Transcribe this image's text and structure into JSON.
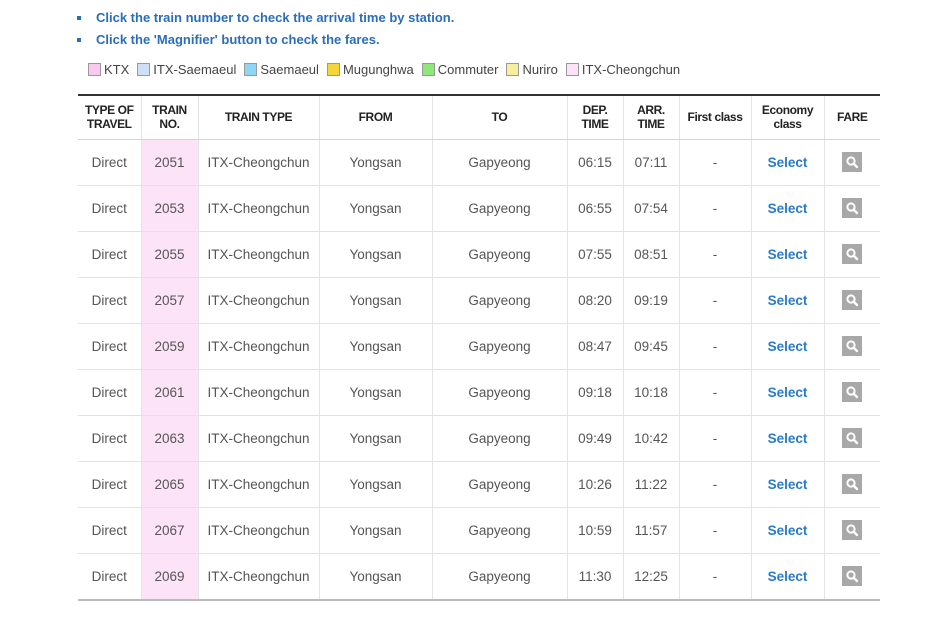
{
  "notes": [
    "Click the train number to check the arrival time by station.",
    "Click the 'Magnifier' button to check the fares."
  ],
  "legend": [
    {
      "label": "KTX",
      "color": "#fbc8f0"
    },
    {
      "label": "ITX-Saemaeul",
      "color": "#cde0f6"
    },
    {
      "label": "Saemaeul",
      "color": "#8fd6f5"
    },
    {
      "label": "Mugunghwa",
      "color": "#f4d53c"
    },
    {
      "label": "Commuter",
      "color": "#8fe77a"
    },
    {
      "label": "Nuriro",
      "color": "#f6ef9c"
    },
    {
      "label": "ITX-Cheongchun",
      "color": "#fde3f7"
    }
  ],
  "table": {
    "headers": {
      "type_line1": "TYPE OF",
      "type_line2": "TRAVEL",
      "no_line1": "TRAIN",
      "no_line2": "NO.",
      "train_type": "TRAIN TYPE",
      "from": "FROM",
      "to": "TO",
      "dep_line1": "DEP.",
      "dep_line2": "TIME",
      "arr_line1": "ARR.",
      "arr_line2": "TIME",
      "first_class": "First class",
      "economy_line1": "Economy",
      "economy_line2": "class",
      "fare": "FARE"
    },
    "rows": [
      {
        "type": "Direct",
        "no": "2051",
        "train_type": "ITX-Cheongchun",
        "from": "Yongsan",
        "to": "Gapyeong",
        "dep": "06:15",
        "arr": "07:11",
        "first": "-",
        "economy": "Select"
      },
      {
        "type": "Direct",
        "no": "2053",
        "train_type": "ITX-Cheongchun",
        "from": "Yongsan",
        "to": "Gapyeong",
        "dep": "06:55",
        "arr": "07:54",
        "first": "-",
        "economy": "Select"
      },
      {
        "type": "Direct",
        "no": "2055",
        "train_type": "ITX-Cheongchun",
        "from": "Yongsan",
        "to": "Gapyeong",
        "dep": "07:55",
        "arr": "08:51",
        "first": "-",
        "economy": "Select"
      },
      {
        "type": "Direct",
        "no": "2057",
        "train_type": "ITX-Cheongchun",
        "from": "Yongsan",
        "to": "Gapyeong",
        "dep": "08:20",
        "arr": "09:19",
        "first": "-",
        "economy": "Select"
      },
      {
        "type": "Direct",
        "no": "2059",
        "train_type": "ITX-Cheongchun",
        "from": "Yongsan",
        "to": "Gapyeong",
        "dep": "08:47",
        "arr": "09:45",
        "first": "-",
        "economy": "Select"
      },
      {
        "type": "Direct",
        "no": "2061",
        "train_type": "ITX-Cheongchun",
        "from": "Yongsan",
        "to": "Gapyeong",
        "dep": "09:18",
        "arr": "10:18",
        "first": "-",
        "economy": "Select"
      },
      {
        "type": "Direct",
        "no": "2063",
        "train_type": "ITX-Cheongchun",
        "from": "Yongsan",
        "to": "Gapyeong",
        "dep": "09:49",
        "arr": "10:42",
        "first": "-",
        "economy": "Select"
      },
      {
        "type": "Direct",
        "no": "2065",
        "train_type": "ITX-Cheongchun",
        "from": "Yongsan",
        "to": "Gapyeong",
        "dep": "10:26",
        "arr": "11:22",
        "first": "-",
        "economy": "Select"
      },
      {
        "type": "Direct",
        "no": "2067",
        "train_type": "ITX-Cheongchun",
        "from": "Yongsan",
        "to": "Gapyeong",
        "dep": "10:59",
        "arr": "11:57",
        "first": "-",
        "economy": "Select"
      },
      {
        "type": "Direct",
        "no": "2069",
        "train_type": "ITX-Cheongchun",
        "from": "Yongsan",
        "to": "Gapyeong",
        "dep": "11:30",
        "arr": "12:25",
        "first": "-",
        "economy": "Select"
      }
    ],
    "fare_icon": "magnifier-icon"
  }
}
